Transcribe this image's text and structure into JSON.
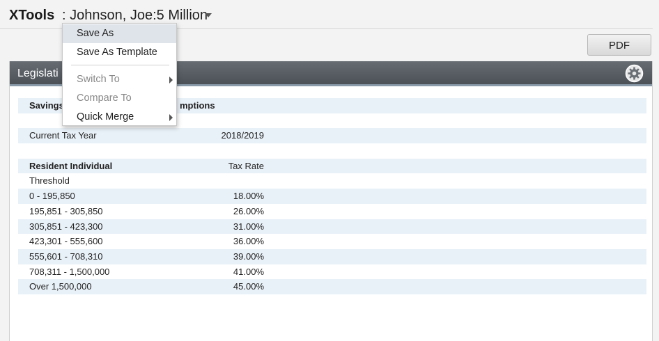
{
  "header": {
    "brand": "XTools",
    "client_label": ": Johnson, Joe:5 Million"
  },
  "toolbar": {
    "pdf_label": "PDF"
  },
  "panel": {
    "title": "Legislati",
    "rows": [
      {
        "c1": "Savings",
        "c2": "",
        "bold": true,
        "shade": true,
        "extra": "mptions"
      },
      {
        "c1": "",
        "c2": "",
        "shade": false
      },
      {
        "c1": "Current Tax Year",
        "c2": "2018/2019",
        "shade": true
      },
      {
        "c1": "",
        "c2": "",
        "shade": false
      },
      {
        "c1": "Resident Individual",
        "c2": "Tax Rate",
        "bold": true,
        "shade": true
      },
      {
        "c1": "Threshold",
        "c2": "",
        "shade": false
      },
      {
        "c1": "0 - 195,850",
        "c2": "18.00%",
        "shade": true
      },
      {
        "c1": "195,851 - 305,850",
        "c2": "26.00%",
        "shade": false
      },
      {
        "c1": "305,851 - 423,300",
        "c2": "31.00%",
        "shade": true
      },
      {
        "c1": "423,301 - 555,600",
        "c2": "36.00%",
        "shade": false
      },
      {
        "c1": "555,601 - 708,310",
        "c2": "39.00%",
        "shade": true
      },
      {
        "c1": "708,311 - 1,500,000",
        "c2": "41.00%",
        "shade": false
      },
      {
        "c1": "Over 1,500,000",
        "c2": "45.00%",
        "shade": true
      }
    ]
  },
  "menu": {
    "items": [
      {
        "label": "Save As",
        "state": "active"
      },
      {
        "label": "Save As Template",
        "state": "normal"
      },
      {
        "label": "Switch To",
        "state": "disabled",
        "submenu": true
      },
      {
        "label": "Compare To",
        "state": "disabled"
      },
      {
        "label": "Quick Merge",
        "state": "normal",
        "submenu": true
      }
    ]
  },
  "icons": {
    "client_dropdown": "caret-down-icon",
    "panel_settings": "gear-icon",
    "submenu": "chevron-right-icon"
  },
  "colors": {
    "panel_header": "#575d63",
    "row_shade": "#e9f1f8",
    "menu_active": "#dfe4ea"
  }
}
